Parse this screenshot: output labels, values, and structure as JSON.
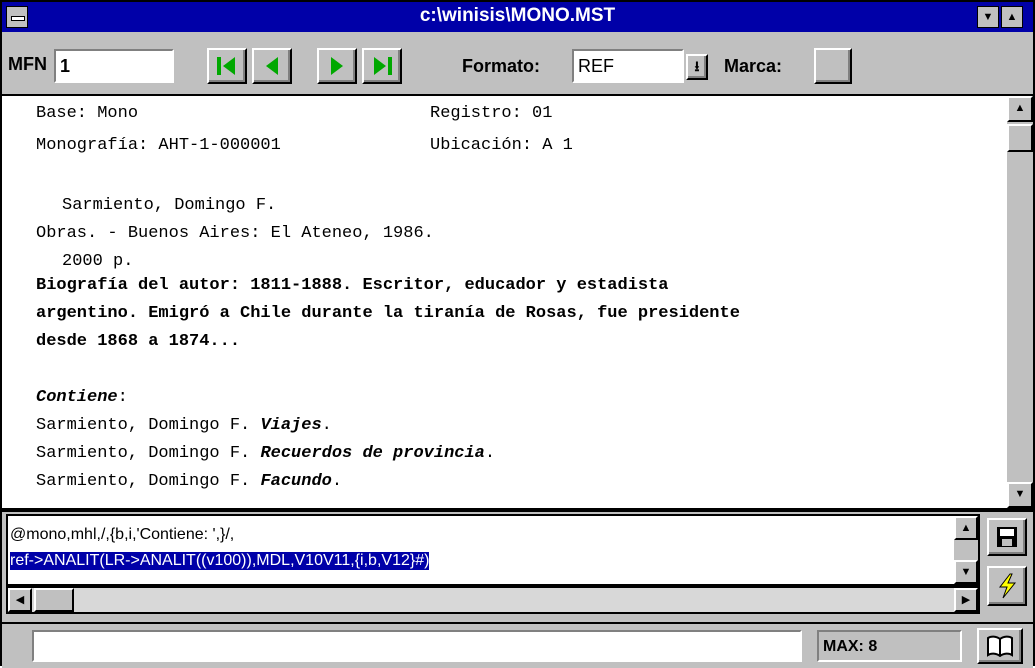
{
  "window": {
    "title": "c:\\winisis\\MONO.MST",
    "system_menu_icon": "window-menu-icon",
    "minimize_icon": "minimize-arrow-icon",
    "maximize_icon": "maximize-arrow-icon"
  },
  "toolbar": {
    "mfn_label": "MFN",
    "mfn_value": "1",
    "nav_buttons": [
      "first-record-icon",
      "previous-record-icon",
      "next-record-icon",
      "last-record-icon"
    ],
    "formato_label": "Formato:",
    "formato_value": "REF",
    "marca_label": "Marca:"
  },
  "record": {
    "base": "Base: Mono",
    "registro": "Registro: 01",
    "monografia": "Monografía: AHT-1-000001",
    "ubicacion": "Ubicación: A 1",
    "author": "Sarmiento, Domingo F.",
    "work": "Obras. - Buenos Aires: El Ateneo, 1986.",
    "pages": "2000 p.",
    "bio_1": "Biografía del autor: 1811-1888. Escritor, educador y estadista",
    "bio_2": "argentino. Emigró a Chile durante la tiranía de Rosas, fue presidente",
    "bio_3": "desde 1868 a 1874...",
    "contiene": "Contiene",
    "contiene_colon": ":",
    "entries": [
      {
        "author": "Sarmiento, Domingo F. ",
        "title": "Viajes",
        "end": "."
      },
      {
        "author": "Sarmiento, Domingo F. ",
        "title": "Recuerdos de provincia",
        "end": "."
      },
      {
        "author": "Sarmiento, Domingo F. ",
        "title": "Facundo",
        "end": "."
      }
    ]
  },
  "format_editor": {
    "line1": "@mono,mhl,/,{b,i,'Contiene: ',}/,",
    "line2": "ref->ANALIT(LR->ANALIT((v100)),MDL,V10V11,{i,b,V12}#)"
  },
  "side_buttons": [
    "save-disk-icon",
    "lightning-icon"
  ],
  "status": {
    "message": "",
    "max": "MAX: 8",
    "book_icon": "open-book-icon"
  },
  "colors": {
    "titlebar": "#0000a8",
    "face": "#c0c0c0",
    "nav_arrow": "#00a800"
  }
}
